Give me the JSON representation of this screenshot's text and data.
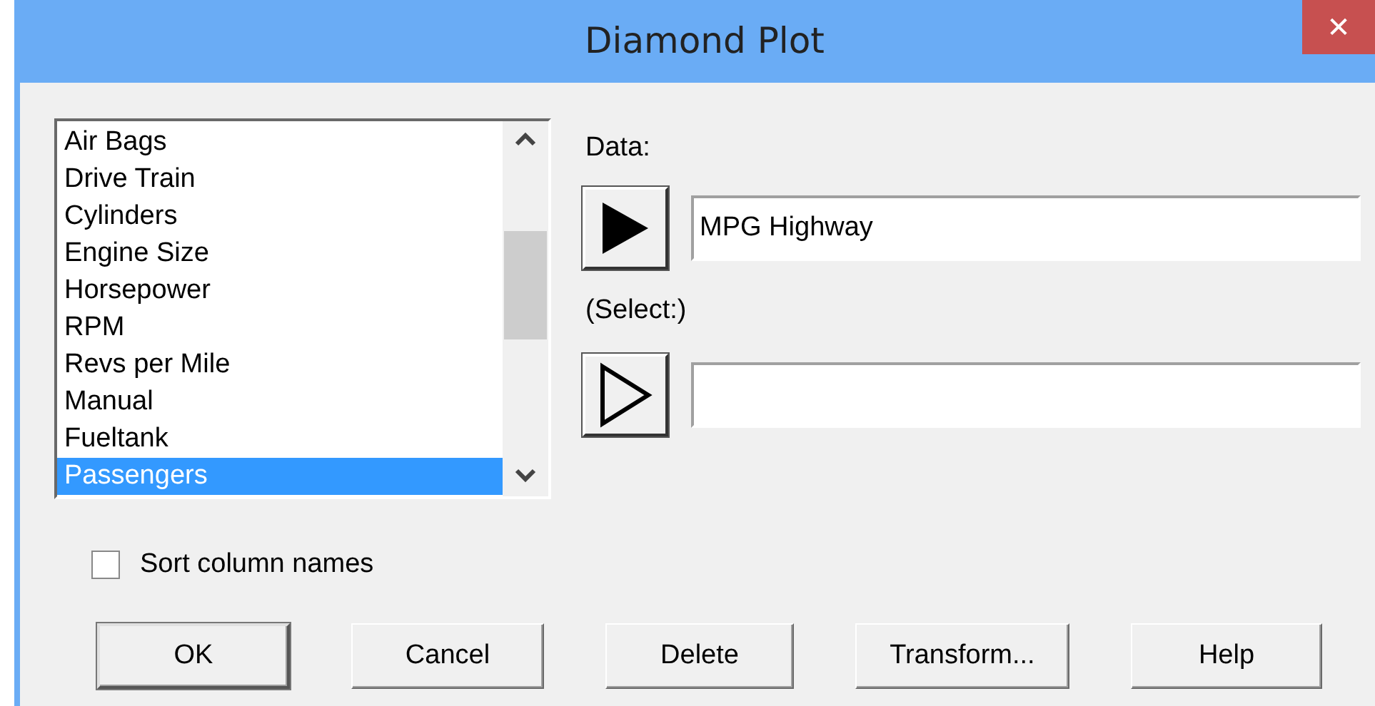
{
  "window": {
    "title": "Diamond Plot",
    "close": "✕"
  },
  "column_list": {
    "items": [
      {
        "label": "Air Bags",
        "selected": false
      },
      {
        "label": "Drive Train",
        "selected": false
      },
      {
        "label": "Cylinders",
        "selected": false
      },
      {
        "label": "Engine Size",
        "selected": false
      },
      {
        "label": "Horsepower",
        "selected": false
      },
      {
        "label": "RPM",
        "selected": false
      },
      {
        "label": "Revs per Mile",
        "selected": false
      },
      {
        "label": "Manual",
        "selected": false
      },
      {
        "label": "Fueltank",
        "selected": false
      },
      {
        "label": "Passengers",
        "selected": true
      }
    ]
  },
  "data_field": {
    "label": "Data:",
    "value": "MPG Highway"
  },
  "select_field": {
    "label": "(Select:)"
  },
  "sort_checkbox": {
    "label": "Sort column names",
    "checked": false
  },
  "buttons": [
    {
      "label": "OK",
      "default": true
    },
    {
      "label": "Cancel",
      "default": false
    },
    {
      "label": "Delete",
      "default": false
    },
    {
      "label": "Transform...",
      "default": false
    },
    {
      "label": "Help",
      "default": false
    }
  ]
}
